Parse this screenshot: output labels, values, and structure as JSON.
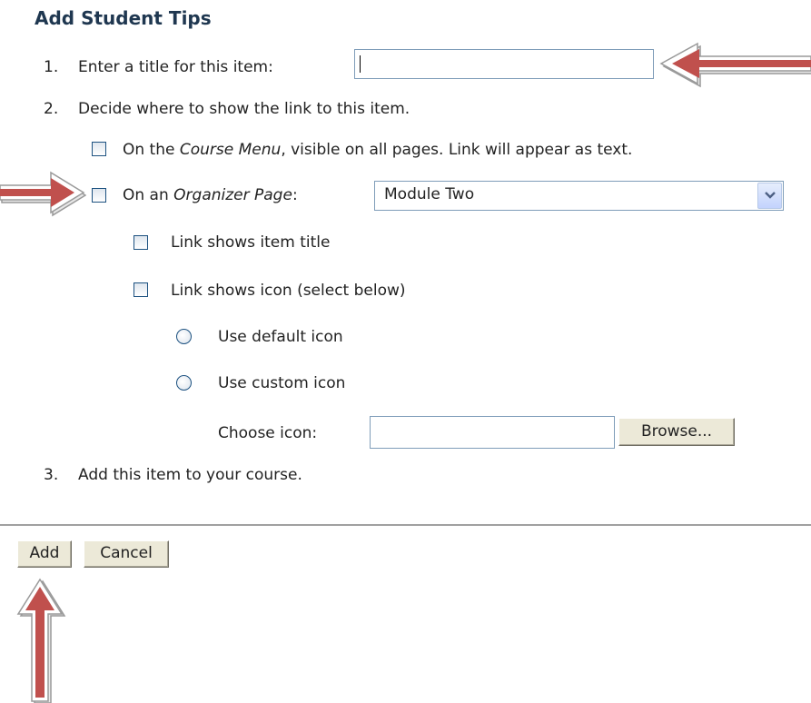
{
  "form": {
    "title": "Add Student Tips",
    "step1": {
      "number": "1.",
      "label": "Enter a title for this item:",
      "value": ""
    },
    "step2": {
      "number": "2.",
      "label": "Decide where to show the link to this item."
    },
    "course_menu": {
      "prefix": "On the ",
      "italic": "Course Menu",
      "suffix": ", visible on all pages. Link will appear as text."
    },
    "organizer": {
      "prefix": "On an ",
      "italic": "Organizer Page",
      "suffix": ":",
      "selected": "Module Two"
    },
    "link_title": "Link shows item title",
    "link_icon": "Link shows icon (select below)",
    "default_icon": "Use default icon",
    "custom_icon": "Use custom icon",
    "choose_icon": {
      "label": "Choose icon:",
      "value": "",
      "browse": "Browse..."
    },
    "step3": {
      "number": "3.",
      "label": "Add this item to your course."
    }
  },
  "buttons": {
    "add": "Add",
    "cancel": "Cancel"
  },
  "colors": {
    "heading": "#1f3750",
    "arrow": "#c0504d",
    "border": "#7f9db9"
  },
  "icons": [
    "arrow-left-icon",
    "arrow-right-icon",
    "arrow-up-icon",
    "chevron-down-icon"
  ]
}
